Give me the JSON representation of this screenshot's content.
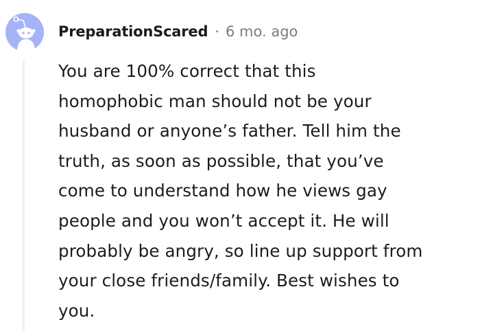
{
  "comment": {
    "username": "PreparationScared",
    "separator": "·",
    "timestamp": "6 mo. ago",
    "avatar_icon": "reddit-snoo-avatar-icon",
    "body_lines": [
      "You are 100% correct that this",
      "homophobic man should not be your",
      "husband or anyone’s father. Tell him the",
      "truth, as soon as possible, that you’ve",
      "come to understand how he views gay",
      "people and you won’t accept it. He will",
      "probably be angry, so line up support from",
      "your close friends/family. Best wishes to",
      "you."
    ]
  },
  "colors": {
    "avatar_bg": "#a5b4f5",
    "snoo": "#ffffff",
    "text": "#1c1c1c",
    "meta": "#7c7c7c",
    "thread_line": "#edeff1"
  }
}
